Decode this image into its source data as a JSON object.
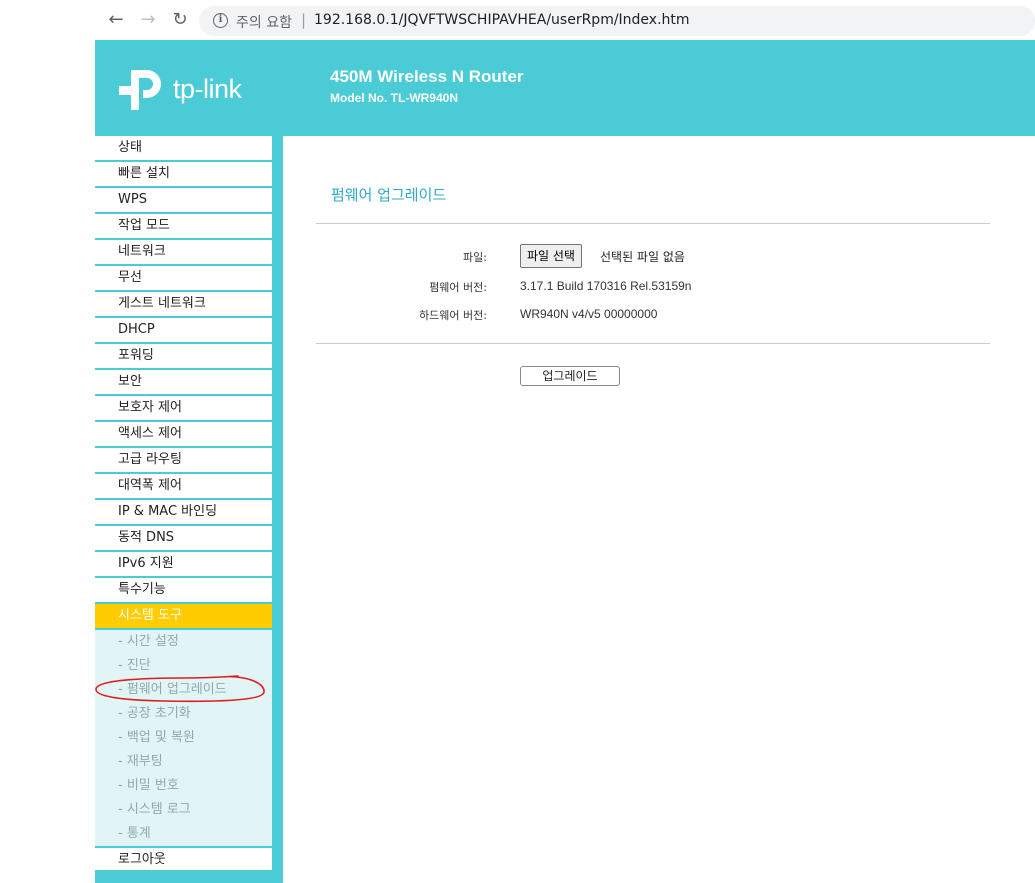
{
  "browser": {
    "back_icon": "←",
    "forward_icon": "→",
    "reload_icon": "↻",
    "info_icon": "i",
    "security_label": "주의 요함",
    "separator": "|",
    "url": "192.168.0.1/JQVFTWSCHIPAVHEA/userRpm/Index.htm"
  },
  "header": {
    "logo_text": "tp-link",
    "title": "450M Wireless N Router",
    "model": "Model No. TL-WR940N",
    "bg_color": "#4acbd6"
  },
  "sidebar": {
    "items": [
      {
        "label": "상태"
      },
      {
        "label": "빠른 설치"
      },
      {
        "label": "WPS"
      },
      {
        "label": "작업 모드"
      },
      {
        "label": "네트워크"
      },
      {
        "label": "무선"
      },
      {
        "label": "게스트 네트워크"
      },
      {
        "label": "DHCP"
      },
      {
        "label": "포워딩"
      },
      {
        "label": "보안"
      },
      {
        "label": "보호자 제어"
      },
      {
        "label": "액세스 제어"
      },
      {
        "label": "고급 라우팅"
      },
      {
        "label": "대역폭 제어"
      },
      {
        "label": "IP & MAC 바인딩"
      },
      {
        "label": "동적 DNS"
      },
      {
        "label": "IPv6 지원"
      },
      {
        "label": "특수기능"
      },
      {
        "label": "시스템 도구",
        "active": true
      }
    ],
    "sub_items": [
      {
        "label": "- 시간 설정"
      },
      {
        "label": "- 진단"
      },
      {
        "label": "- 펌웨어 업그레이드",
        "selected": true
      },
      {
        "label": "- 공장 초기화"
      },
      {
        "label": "- 백업 및 복원"
      },
      {
        "label": "- 재부팅"
      },
      {
        "label": "- 비밀 번호"
      },
      {
        "label": "- 시스템 로그"
      },
      {
        "label": "- 통계"
      }
    ],
    "logout_label": "로그아웃",
    "active_color": "#ffcc00"
  },
  "main": {
    "title": "펌웨어 업그레이드",
    "file_label": "파일:",
    "file_button_label": "파일 선택",
    "no_file_text": "선택된 파일 없음",
    "fw_version_label": "펌웨어 버전:",
    "fw_version_value": "3.17.1 Build 170316 Rel.53159n",
    "hw_version_label": "하드웨어 버전:",
    "hw_version_value": "WR940N v4/v5 00000000",
    "upgrade_button_label": "업그레이드"
  }
}
